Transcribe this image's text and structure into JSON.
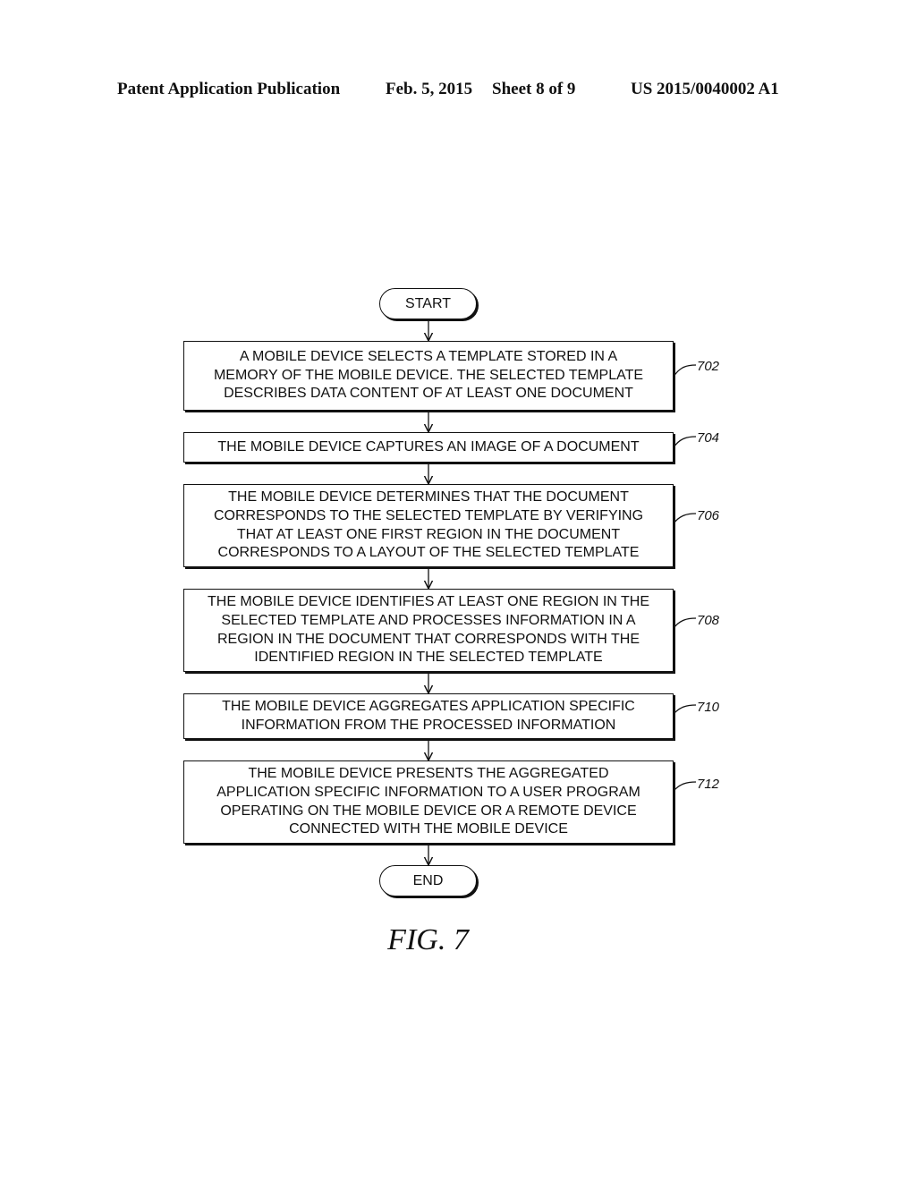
{
  "header": {
    "publication": "Patent Application Publication",
    "date": "Feb. 5, 2015",
    "sheet": "Sheet 8 of 9",
    "number": "US 2015/0040002 A1"
  },
  "flowchart": {
    "start_label": "START",
    "end_label": "END",
    "steps": [
      {
        "ref": "702",
        "lines": [
          "A MOBILE DEVICE SELECTS A TEMPLATE STORED IN A",
          "MEMORY OF THE MOBILE DEVICE. THE SELECTED TEMPLATE",
          "DESCRIBES DATA CONTENT OF AT LEAST ONE DOCUMENT"
        ]
      },
      {
        "ref": "704",
        "lines": [
          "THE MOBILE DEVICE CAPTURES AN IMAGE OF A DOCUMENT"
        ]
      },
      {
        "ref": "706",
        "lines": [
          "THE MOBILE DEVICE DETERMINES THAT THE DOCUMENT",
          "CORRESPONDS TO THE SELECTED TEMPLATE BY VERIFYING",
          "THAT AT LEAST ONE FIRST REGION IN THE DOCUMENT",
          "CORRESPONDS TO A LAYOUT OF THE SELECTED TEMPLATE"
        ]
      },
      {
        "ref": "708",
        "lines": [
          "THE MOBILE DEVICE IDENTIFIES AT LEAST ONE REGION IN THE",
          "SELECTED TEMPLATE AND PROCESSES INFORMATION IN A",
          "REGION IN THE DOCUMENT THAT CORRESPONDS WITH THE",
          "IDENTIFIED REGION IN THE SELECTED TEMPLATE"
        ]
      },
      {
        "ref": "710",
        "lines": [
          "THE MOBILE DEVICE AGGREGATES APPLICATION SPECIFIC",
          "INFORMATION FROM THE PROCESSED INFORMATION"
        ]
      },
      {
        "ref": "712",
        "lines": [
          "THE MOBILE DEVICE PRESENTS THE AGGREGATED",
          "APPLICATION SPECIFIC INFORMATION TO A USER PROGRAM",
          "OPERATING ON THE MOBILE DEVICE OR A REMOTE DEVICE",
          "CONNECTED WITH THE MOBILE DEVICE"
        ]
      }
    ]
  },
  "figure_label": "FIG. 7"
}
